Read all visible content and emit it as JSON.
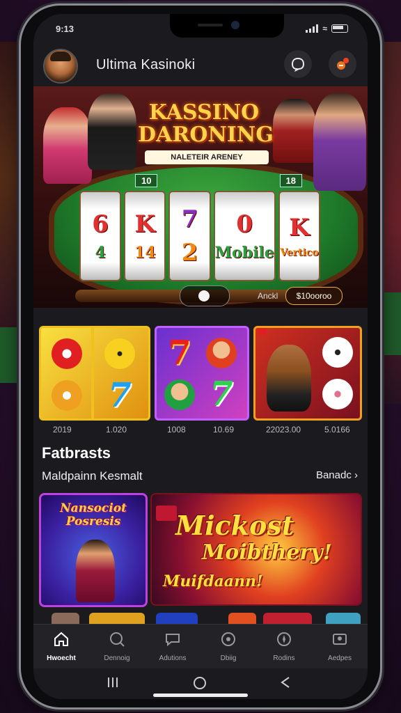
{
  "status_bar": {
    "time": "9:13"
  },
  "header": {
    "title": "Ultima Kasinoki",
    "icons": {
      "avatar": "user-avatar",
      "chat": "chat-icon",
      "notifications": "bell-icon"
    }
  },
  "hero": {
    "title_line1": "KASSINO",
    "title_line2": "DARONING",
    "subtitle": "NALETEIR ARENEY",
    "reel_numbers": [
      "10",
      "18"
    ],
    "reel_symbols": [
      [
        "6",
        "4"
      ],
      [
        "K",
        "14"
      ],
      [
        "7",
        "2"
      ],
      [
        "0",
        "Mobile"
      ],
      [
        "K",
        "Vertico"
      ]
    ],
    "info_label": "Anckl",
    "info_value": "$10ooroo"
  },
  "games": {
    "captions": [
      "2019",
      "1.020",
      "1008",
      "10.69",
      "22023.00",
      "5.0166"
    ]
  },
  "section": {
    "title": "Fatbrasts",
    "subtitle": "Maldpainn Kesmalt",
    "link": "Banadc"
  },
  "promos": [
    {
      "text": "Nansociot Posresis"
    },
    {
      "line1": "Mickost",
      "line2": "Moibthery!",
      "line3": "Muifdaann!"
    }
  ],
  "bottom_nav": [
    {
      "label": "Hwoecht",
      "icon": "home-icon",
      "active": true
    },
    {
      "label": "Dennoig",
      "icon": "search-icon",
      "active": false
    },
    {
      "label": "Adutions",
      "icon": "chat-icon",
      "active": false
    },
    {
      "label": "Dbiig",
      "icon": "wallet-icon",
      "active": false
    },
    {
      "label": "Rodins",
      "icon": "compass-icon",
      "active": false
    },
    {
      "label": "Aedpes",
      "icon": "profile-icon",
      "active": false
    }
  ],
  "colors": {
    "accent_gold": "#ffd44a",
    "screen_bg": "#1b1b1f",
    "nav_bg": "#232327"
  }
}
